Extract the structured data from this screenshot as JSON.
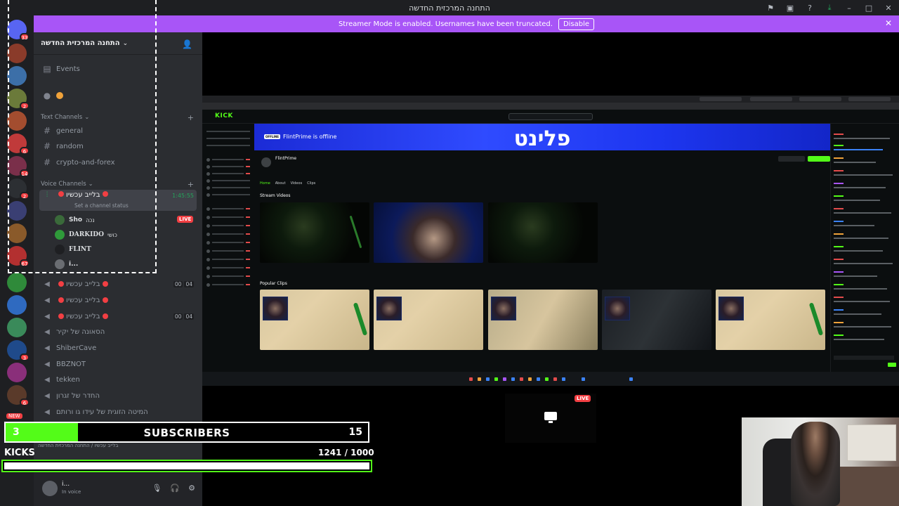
{
  "window": {
    "title": "התחנה המרכזית החדשה"
  },
  "banner": {
    "text": "Streamer Mode is enabled. Usernames have been truncated.",
    "button": "Disable"
  },
  "rail": {
    "badges": [
      "33",
      "2",
      "6",
      "14",
      "2",
      "3",
      "67",
      "3",
      "6",
      "605"
    ],
    "new_label": "NEW"
  },
  "server": {
    "name": "התחנה המרכזית החדשה",
    "events_label": "Events",
    "text_category": "Text Channels",
    "text_channels": [
      "general",
      "random",
      "crypto-and-forex"
    ],
    "voice_category": "Voice Channels",
    "active_voice": {
      "name": "בלייב עכשיו",
      "timer": "1:45:55",
      "status": "Set a channel status"
    },
    "voice_users": [
      {
        "name": "Sho",
        "extra": "נכה"
      },
      {
        "name": "DARKIDO",
        "extra": "כושי"
      },
      {
        "name": "FLINT",
        "extra": ""
      },
      {
        "name": "i...",
        "extra": ""
      }
    ],
    "live_label": "LIVE",
    "other_voice": [
      {
        "name": "בלייב עכשיו",
        "count_a": "00",
        "count_b": "04"
      },
      {
        "name": "בלייב עכשיו",
        "count_a": "",
        "count_b": ""
      },
      {
        "name": "בלייב עכשיו",
        "count_a": "00",
        "count_b": "04"
      },
      {
        "name": "הסאונה של יקיר",
        "count_a": "",
        "count_b": ""
      },
      {
        "name": "ShiberCave",
        "count_a": "",
        "count_b": ""
      },
      {
        "name": "BBZNOT",
        "count_a": "",
        "count_b": ""
      },
      {
        "name": "tekken",
        "count_a": "",
        "count_b": ""
      },
      {
        "name": "החדר של זגרון",
        "count_a": "",
        "count_b": ""
      },
      {
        "name": "המיטה הזוגית של עידו גו ורותם",
        "count_a": "",
        "count_b": ""
      }
    ]
  },
  "user_panel": {
    "name": "i...",
    "status": "In voice",
    "breadcrumb": "בלייב עכשיו / התחנה המרכזית החדשה"
  },
  "overlay": {
    "subscribers_label": "SUBSCRIBERS",
    "subscribers_current": "3",
    "subscribers_goal": "15",
    "subscribers_progress": 0.2,
    "kicks_label": "KICKS",
    "kicks_current": "1241",
    "kicks_goal": "1000",
    "kicks_progress": 1.0
  },
  "stream_preview": {
    "offline_text": "FlintPrime is offline",
    "offline_tag": "OFFLINE",
    "banner_title": "פלינט",
    "channel_name": "FlintPrime",
    "tabs": [
      "Home",
      "About",
      "Videos",
      "Clips"
    ],
    "sections": [
      "Stream Videos",
      "Popular Clips"
    ],
    "live_label": "LIVE",
    "kick_logo": "KICK"
  },
  "colors": {
    "banner": "#a855f7",
    "kick_green": "#53fc18",
    "live_red": "#f23f43"
  }
}
